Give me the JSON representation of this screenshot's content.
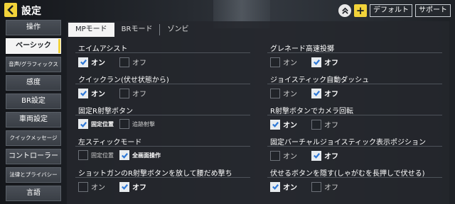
{
  "header": {
    "title": "設定",
    "default_label": "デフォルト",
    "support_label": "サポート",
    "plus_label": "+"
  },
  "sidebar": {
    "items": [
      {
        "label": "操作"
      },
      {
        "label": "ベーシック"
      },
      {
        "label": "音声/グラフィックス"
      },
      {
        "label": "感度"
      },
      {
        "label": "BR設定"
      },
      {
        "label": "車両設定"
      },
      {
        "label": "クイックメッセージ"
      },
      {
        "label": "コントローラー"
      },
      {
        "label": "法律とプライバシー"
      },
      {
        "label": "言語"
      }
    ],
    "active_index": 1
  },
  "tabs": [
    {
      "label": "MPモード"
    },
    {
      "label": "BRモード"
    },
    {
      "label": "ゾンビ"
    }
  ],
  "settings_left": [
    {
      "label": "エイムアシスト",
      "options": [
        {
          "label": "オン",
          "checked": true
        },
        {
          "label": "オフ",
          "checked": false
        }
      ]
    },
    {
      "label": "クイックラン(伏せ状態から)",
      "options": [
        {
          "label": "オン",
          "checked": true
        },
        {
          "label": "オフ",
          "checked": false
        }
      ]
    },
    {
      "label": "固定R射撃ボタン",
      "options": [
        {
          "label": "固定位置",
          "checked": true
        },
        {
          "label": "追跡射撃",
          "checked": false
        }
      ]
    },
    {
      "label": "左スティックモード",
      "options": [
        {
          "label": "固定位置",
          "checked": false
        },
        {
          "label": "全画面操作",
          "checked": true
        }
      ]
    },
    {
      "label": "ショットガンのR射撃ボタンを放して腰だめ撃ち",
      "options": [
        {
          "label": "オン",
          "checked": false
        },
        {
          "label": "オフ",
          "checked": true
        }
      ]
    }
  ],
  "settings_right": [
    {
      "label": "グレネード高速投擲",
      "options": [
        {
          "label": "オン",
          "checked": false
        },
        {
          "label": "オフ",
          "checked": true
        }
      ]
    },
    {
      "label": "ジョイスティック自動ダッシュ",
      "options": [
        {
          "label": "オン",
          "checked": false
        },
        {
          "label": "オフ",
          "checked": true
        }
      ]
    },
    {
      "label": "R射撃ボタンでカメラ回転",
      "options": [
        {
          "label": "オン",
          "checked": true
        },
        {
          "label": "オフ",
          "checked": false
        }
      ]
    },
    {
      "label": "固定バーチャルジョイスティック表示ポジション",
      "options": [
        {
          "label": "オン",
          "checked": false
        },
        {
          "label": "オフ",
          "checked": true
        }
      ]
    },
    {
      "label": "伏せるボタンを隠す(しゃがむを長押しで伏せる)",
      "options": [
        {
          "label": "オン",
          "checked": true
        },
        {
          "label": "オフ",
          "checked": false
        }
      ]
    }
  ],
  "colors": {
    "accent": "#f2d33a",
    "active_bg": "#f4f4f4"
  }
}
